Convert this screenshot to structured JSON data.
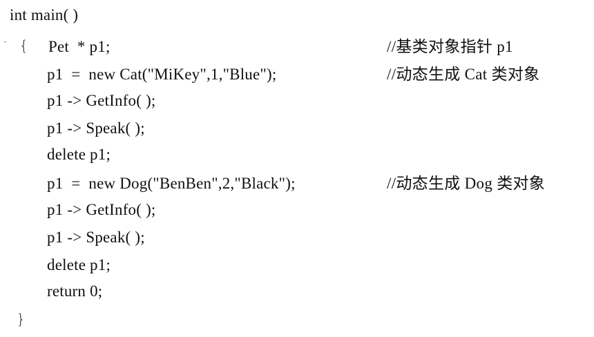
{
  "code": {
    "header": "int main( )",
    "open_brace": "{",
    "close_brace": "}",
    "lines": [
      "Pet  * p1;",
      "p1  =  new Cat(\"MiKey\",1,\"Blue\");",
      "p1 -> GetInfo( );",
      "p1 -> Speak( );",
      "delete p1;",
      "p1  =  new Dog(\"BenBen\",2,\"Black\");",
      "p1 -> GetInfo( );",
      "p1 -> Speak( );",
      "delete p1;",
      "return 0;"
    ],
    "comments": [
      "//基类对象指针 p1",
      "//动态生成 Cat 类对象",
      "//动态生成 Dog 类对象"
    ]
  }
}
